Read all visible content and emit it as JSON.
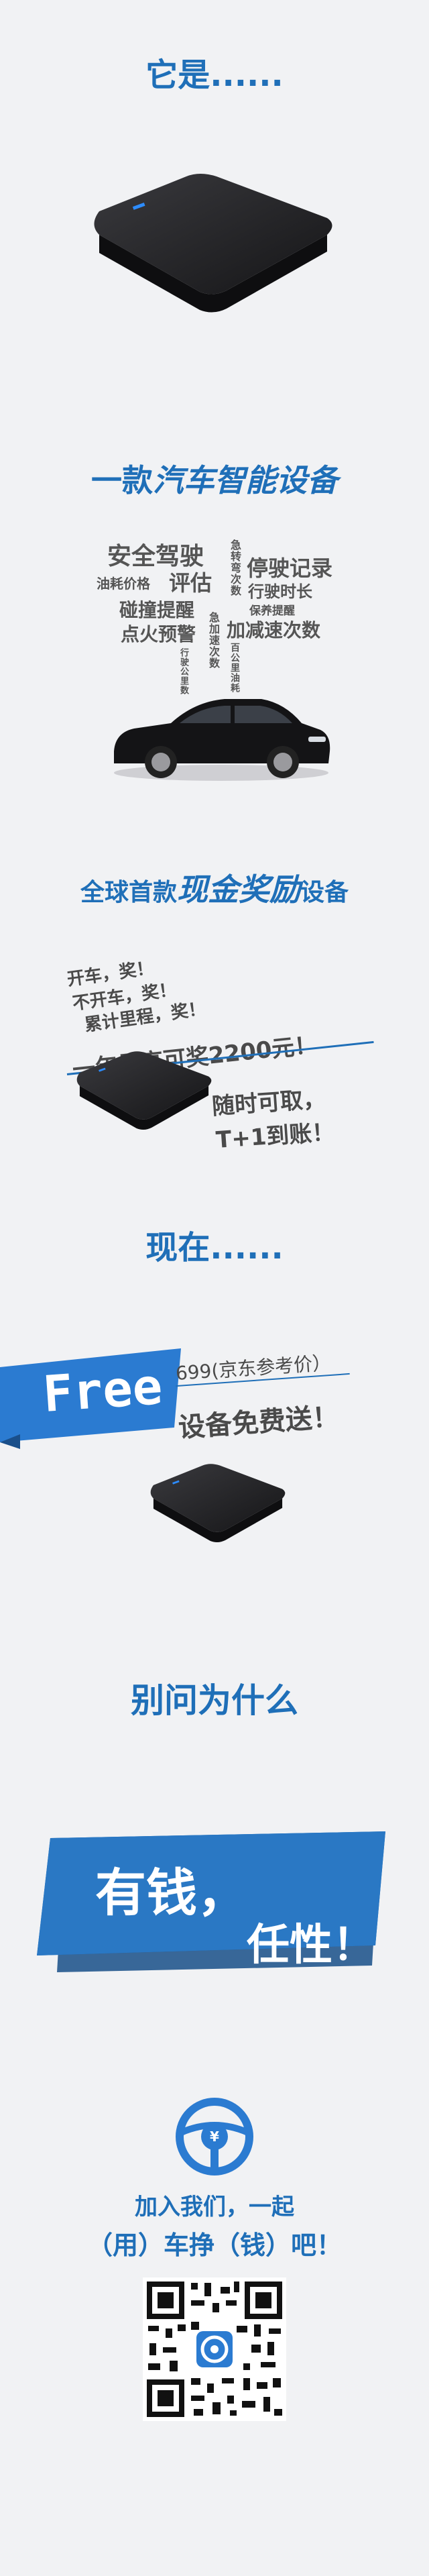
{
  "section1": {
    "heading": "它是......"
  },
  "section2": {
    "heading_prefix": "一款",
    "heading_emph": "汽车智能设备",
    "features": {
      "safe_driving": "安全驾驶",
      "fuel_price": "油耗价格",
      "evaluate": "评估",
      "collision": "碰撞提醒",
      "ignition": "点火预警",
      "turns": "急转弯次数",
      "accel_times": "急加速次数",
      "parking": "停驶记录",
      "driving_time": "行驶时长",
      "maintenance": "保养提醒",
      "decel": "加减速次数",
      "km": "行驶公里数",
      "fuel_100": "百公里油耗"
    }
  },
  "section3": {
    "heading_prefix": "全球首款",
    "heading_emph": "现金奖励",
    "heading_suffix": "设备",
    "line1": "开车，奖！",
    "line2": "不开车，奖！",
    "line3": "累计里程，奖！",
    "highlight": "一年最高可奖2200元！",
    "withdraw1": "随时可取，",
    "withdraw2": "T+1到账！"
  },
  "section4": {
    "heading": "现在......",
    "free_label": "Free",
    "price_note": "699(京东参考价）",
    "free_gift": "设备免费送！"
  },
  "section5": {
    "heading": "别问为什么",
    "banner_line1": "有钱，",
    "banner_line2": "任性！"
  },
  "section6": {
    "join_line1": "加入我们，一起",
    "join_line2": "（用）车挣（钱）吧！"
  },
  "colors": {
    "accent": "#1f6fb8",
    "background": "#f1f2f4",
    "device": "#1c1c1e"
  },
  "icons": {
    "steering": "steering-wheel-yuan-icon",
    "qr": "qr-code"
  }
}
